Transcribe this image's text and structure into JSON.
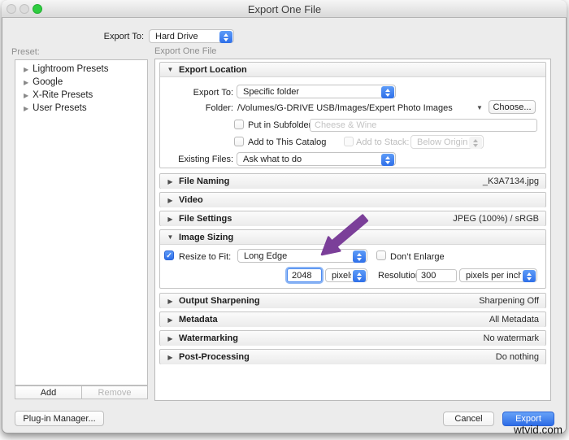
{
  "window": {
    "title": "Export One File"
  },
  "header": {
    "export_to_label": "Export To:",
    "export_to_value": "Hard Drive"
  },
  "sidebar": {
    "preset_label": "Preset:",
    "items": [
      {
        "label": "Lightroom Presets"
      },
      {
        "label": "Google"
      },
      {
        "label": "X-Rite Presets"
      },
      {
        "label": "User Presets"
      }
    ],
    "add_label": "Add",
    "remove_label": "Remove"
  },
  "main": {
    "panel_title": "Export One File",
    "export_location": {
      "title": "Export Location",
      "export_to_label": "Export To:",
      "export_to_value": "Specific folder",
      "folder_label": "Folder:",
      "folder_path": "/Volumes/G-DRIVE USB/Images/Expert Photo Images",
      "choose_label": "Choose...",
      "subfolder_label": "Put in Subfolder:",
      "subfolder_placeholder": "Cheese & Wine",
      "add_catalog_label": "Add to This Catalog",
      "add_stack_label": "Add to Stack:",
      "add_stack_value": "Below Original",
      "existing_label": "Existing Files:",
      "existing_value": "Ask what to do"
    },
    "file_naming": {
      "title": "File Naming",
      "value": "_K3A7134.jpg"
    },
    "video": {
      "title": "Video",
      "value": ""
    },
    "file_settings": {
      "title": "File Settings",
      "value": "JPEG (100%) / sRGB"
    },
    "image_sizing": {
      "title": "Image Sizing",
      "resize_label": "Resize to Fit:",
      "resize_value": "Long Edge",
      "dont_enlarge_label": "Don’t Enlarge",
      "size_value": "2048",
      "size_unit": "pixels",
      "resolution_label": "Resolution:",
      "resolution_value": "300",
      "resolution_unit": "pixels per inch"
    },
    "output_sharpening": {
      "title": "Output Sharpening",
      "value": "Sharpening Off"
    },
    "metadata": {
      "title": "Metadata",
      "value": "All Metadata"
    },
    "watermarking": {
      "title": "Watermarking",
      "value": "No watermark"
    },
    "post_processing": {
      "title": "Post-Processing",
      "value": "Do nothing"
    }
  },
  "footer": {
    "plugin_manager_label": "Plug-in Manager...",
    "cancel_label": "Cancel",
    "export_label": "Export"
  },
  "watermark": "wtvid.com",
  "icons": {
    "disclosure_open": "▼",
    "disclosure_closed": "▶",
    "tree_arrow": "▶",
    "folder_menu_arrow": "▼",
    "checkmark": "✓"
  },
  "colors": {
    "accent_blue": "#2e6fe9",
    "export_button_blue": "#2d6ce6",
    "arrow_purple": "#7b3f99",
    "traffic_green": "#2ecc40"
  }
}
